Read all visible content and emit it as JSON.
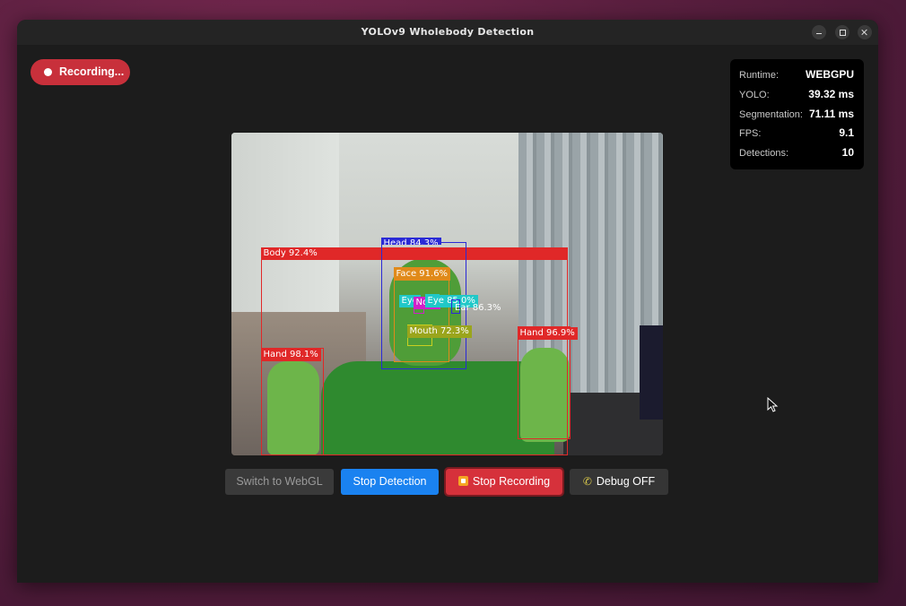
{
  "window": {
    "title": "YOLOv9 Wholebody Detection"
  },
  "recording_badge": {
    "label": "Recording..."
  },
  "stats": [
    {
      "label": "Runtime:",
      "value": "WEBGPU"
    },
    {
      "label": "YOLO:",
      "value": "39.32 ms"
    },
    {
      "label": "Segmentation:",
      "value": "71.11 ms"
    },
    {
      "label": "FPS:",
      "value": "9.1"
    },
    {
      "label": "Detections:",
      "value": "10"
    }
  ],
  "detections": [
    {
      "label": "Body 92.4%",
      "color": "#e02828"
    },
    {
      "label": "Head 84.3%",
      "color": "#2a2ad6"
    },
    {
      "label": "Face 91.6%",
      "color": "#e08a1a"
    },
    {
      "label": "Eye",
      "color": "#20c8c8"
    },
    {
      "label": "Nose",
      "color": "#d020c8"
    },
    {
      "label": "Eye 85.0%",
      "color": "#20c8c8"
    },
    {
      "label": "Ear 86.3%",
      "color": "#2a2ad6"
    },
    {
      "label": "Mouth 72.3%",
      "color": "#c8d020"
    },
    {
      "label": "Hand 98.1%",
      "color": "#e02828"
    },
    {
      "label": "Hand 96.9%",
      "color": "#e02828"
    }
  ],
  "buttons": {
    "switch_webgl": "Switch to WebGL",
    "stop_detection": "Stop Detection",
    "stop_recording": "Stop Recording",
    "debug": "Debug OFF"
  },
  "icons": {
    "record": "record-dot-icon",
    "stop_square": "stop-square-icon",
    "debug": "phone-icon"
  }
}
